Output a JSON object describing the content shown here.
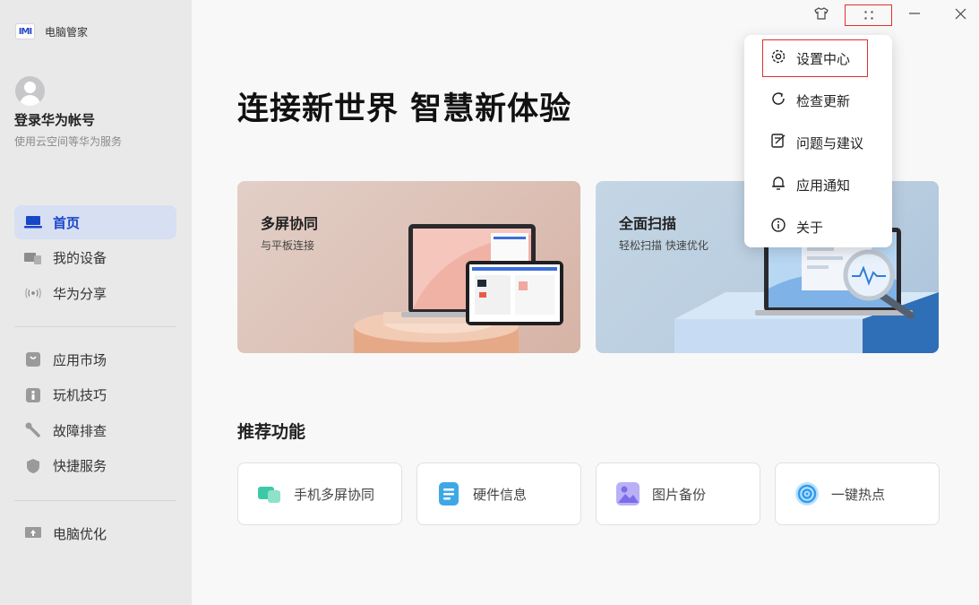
{
  "app": {
    "name": "电脑管家",
    "logo_text": "IMI"
  },
  "account": {
    "title": "登录华为帐号",
    "subtitle": "使用云空间等华为服务"
  },
  "nav_primary": [
    {
      "label": "首页",
      "icon": "laptop-icon",
      "active": true
    },
    {
      "label": "我的设备",
      "icon": "devices-icon",
      "active": false
    },
    {
      "label": "华为分享",
      "icon": "share-wave-icon",
      "active": false
    }
  ],
  "nav_secondary": [
    {
      "label": "应用市场",
      "icon": "app-store-icon"
    },
    {
      "label": "玩机技巧",
      "icon": "tips-icon"
    },
    {
      "label": "故障排查",
      "icon": "wrench-icon"
    },
    {
      "label": "快捷服务",
      "icon": "shield-icon"
    }
  ],
  "nav_tertiary": [
    {
      "label": "电脑优化",
      "icon": "optimize-icon"
    }
  ],
  "hero": {
    "title": "连接新世界 智慧新体验"
  },
  "cards": [
    {
      "title": "多屏协同",
      "subtitle": "与平板连接"
    },
    {
      "title": "全面扫描",
      "subtitle": "轻松扫描 快速优化"
    }
  ],
  "recommend": {
    "title": "推荐功能",
    "items": [
      {
        "label": "手机多屏协同",
        "icon": "multi-screen-icon",
        "color": "#3ec9a6"
      },
      {
        "label": "硬件信息",
        "icon": "hardware-info-icon",
        "color": "#3ea8e6"
      },
      {
        "label": "图片备份",
        "icon": "image-backup-icon",
        "color": "#8a7cf0"
      },
      {
        "label": "一键热点",
        "icon": "hotspot-icon",
        "color": "#2f9cf0"
      }
    ]
  },
  "menu": {
    "items": [
      {
        "label": "设置中心",
        "icon": "gear-icon"
      },
      {
        "label": "检查更新",
        "icon": "refresh-icon"
      },
      {
        "label": "问题与建议",
        "icon": "feedback-icon"
      },
      {
        "label": "应用通知",
        "icon": "bell-icon"
      },
      {
        "label": "关于",
        "icon": "info-icon"
      }
    ]
  },
  "colors": {
    "accent": "#1a47c8",
    "highlight_border": "#e03030"
  }
}
